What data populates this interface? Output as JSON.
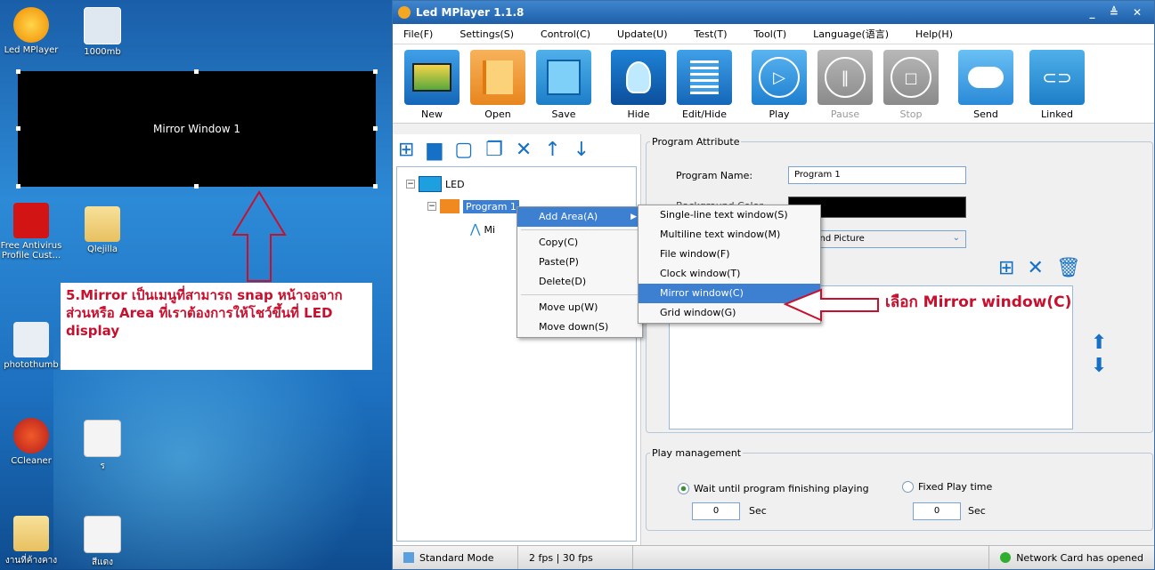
{
  "desktop": {
    "icons": [
      {
        "label": "Led MPlayer"
      },
      {
        "label": "1000mb"
      },
      {
        "label": "Free Antivirus Profile Cust..."
      },
      {
        "label": "Qlejilla"
      },
      {
        "label": "photothumb"
      },
      {
        "label": "CCleaner"
      },
      {
        "label": "ร"
      },
      {
        "label": "งานที่ค้างคาง"
      },
      {
        "label": "สีแดง"
      }
    ],
    "mirror_window_label": "Mirror Window 1",
    "annotation_text": "5.Mirror เป็นเมนูที่สามารถ snap หน้าจอจากส่วนหรือ Area ที่เราต้องการให้โชว์ขึ้นที่ LED display",
    "callout_text": "เลือก Mirror window(C)"
  },
  "app": {
    "title": "Led MPlayer 1.1.8",
    "window_controls": "_ ≜ ✕",
    "menu": [
      "File(F)",
      "Settings(S)",
      "Control(C)",
      "Update(U)",
      "Test(T)",
      "Tool(T)",
      "Language(语言)",
      "Help(H)"
    ],
    "toolbar": [
      {
        "label": "New",
        "icon": "monitor-icon"
      },
      {
        "label": "Open",
        "icon": "folder-open-icon"
      },
      {
        "label": "Save",
        "icon": "save-icon"
      },
      {
        "label": "Hide",
        "icon": "lightbulb-icon"
      },
      {
        "label": "Edit/Hide",
        "icon": "pencil-icon"
      },
      {
        "label": "Play",
        "icon": "play-icon"
      },
      {
        "label": "Pause",
        "icon": "pause-icon"
      },
      {
        "label": "Stop",
        "icon": "stop-icon"
      },
      {
        "label": "Send",
        "icon": "cloud-send-icon"
      },
      {
        "label": "Linked",
        "icon": "link-icon"
      }
    ],
    "tree": {
      "root": "LED",
      "program": "Program 1",
      "child": "Mi"
    },
    "context_menu": {
      "items": [
        "Add Area(A)",
        "Copy(C)",
        "Paste(P)",
        "Delete(D)",
        "Move up(W)",
        "Move down(S)"
      ]
    },
    "submenu": {
      "items": [
        "Single-line text window(S)",
        "Multiline text window(M)",
        "File window(F)",
        "Clock window(T)",
        "Mirror window(C)",
        "Grid window(G)"
      ],
      "highlighted": "Mirror window(C)"
    },
    "program_attribute": {
      "legend": "Program Attribute",
      "name_label": "Program Name:",
      "name_value": "Program 1",
      "background_label": "Background Color",
      "bg_select_value": "kground Picture"
    },
    "play_management": {
      "legend": "Play management",
      "option1": "Wait until program finishing playing",
      "option2": "Fixed Play time",
      "value1": "0",
      "value2": "0",
      "unit": "Sec",
      "selected": "Wait until program finishing playing"
    },
    "status": {
      "mode": "Standard Mode",
      "fps": "2 fps | 30 fps",
      "network": "Network Card has opened"
    }
  }
}
